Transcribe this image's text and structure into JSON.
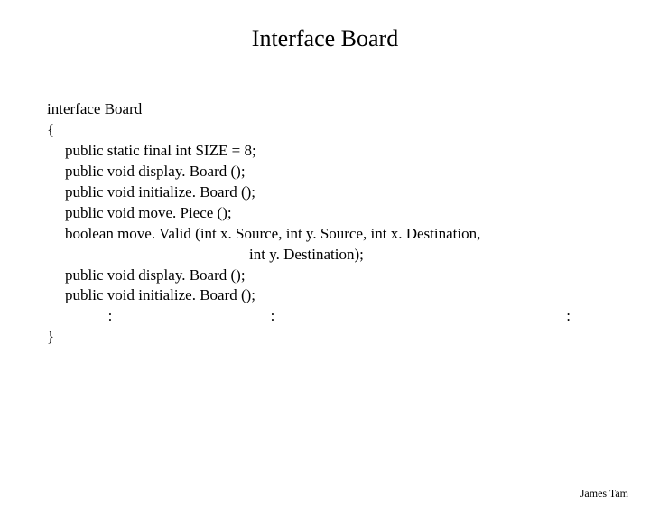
{
  "title": "Interface Board",
  "code": {
    "line1": "interface Board",
    "open_brace": "{",
    "lines": [
      "public static final int SIZE = 8;",
      "public void display. Board ();",
      "public void initialize. Board ();",
      "public void move. Piece ();",
      "boolean move. Valid (int x. Source, int y. Source, int x. Destination,",
      "                                                int y. Destination);",
      "public void display. Board ();",
      "public void initialize. Board ();"
    ],
    "dots": [
      ":",
      ":",
      ":"
    ],
    "close_brace": "}"
  },
  "footer": "James Tam"
}
